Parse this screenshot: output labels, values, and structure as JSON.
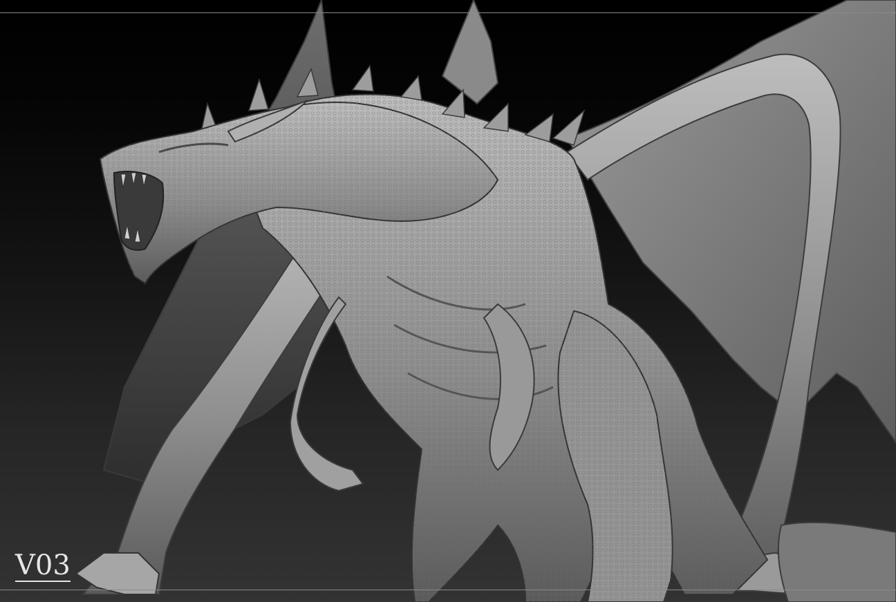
{
  "image": {
    "subject": "dragon-sculpt",
    "palette": {
      "background_top": "#000000",
      "background_bottom": "#333333",
      "clay_light": "#b4b4b4",
      "clay_mid": "#8c8c8c",
      "clay_dark": "#4a4a4a",
      "frame_line": "#8a8a8a",
      "label": "#e6e6e6"
    }
  },
  "label": {
    "version": "V03"
  }
}
